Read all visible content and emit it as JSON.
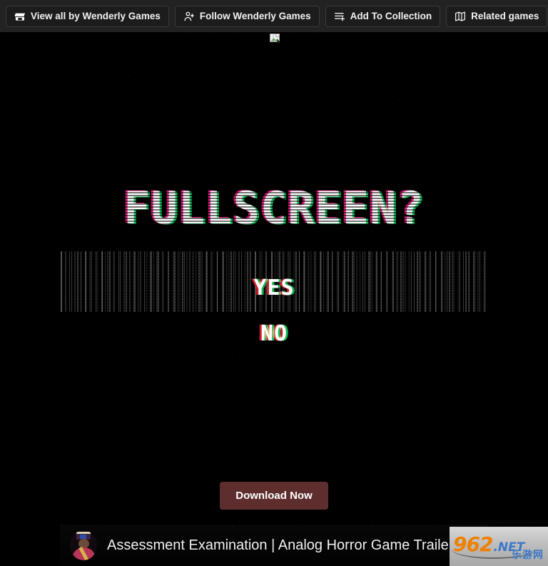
{
  "toolbar": {
    "buttons": [
      {
        "label": "View all by Wenderly Games",
        "icon": "itchio-logo-icon"
      },
      {
        "label": "Follow Wenderly Games",
        "icon": "person-plus-icon"
      },
      {
        "label": "Add To Collection",
        "icon": "list-plus-icon"
      },
      {
        "label": "Related games",
        "icon": "map-icon"
      }
    ],
    "background_color": "#222222"
  },
  "game": {
    "broken_image_icon": "broken-image-icon",
    "title": "FULLSCREEN?",
    "options": {
      "yes": "YES",
      "no": "NO"
    },
    "glitch_colors": {
      "base": "#ffffff",
      "magenta": "#ff1f8f",
      "green": "#14e06a",
      "red": "#e02030",
      "option_green": "#18c85a"
    },
    "background_color": "#000000"
  },
  "download": {
    "label": "Download Now",
    "background_color": "#5e2e2e",
    "text_color": "#ffffff"
  },
  "video_overlay": {
    "title": "Assessment Examination | Analog Horror Game Trailer",
    "avatar": "channel-avatar"
  },
  "watermark": {
    "number": "962",
    "tld": ".NET",
    "chinese": "乐游网",
    "orange": "#f08000",
    "blue": "#3c78c8"
  }
}
